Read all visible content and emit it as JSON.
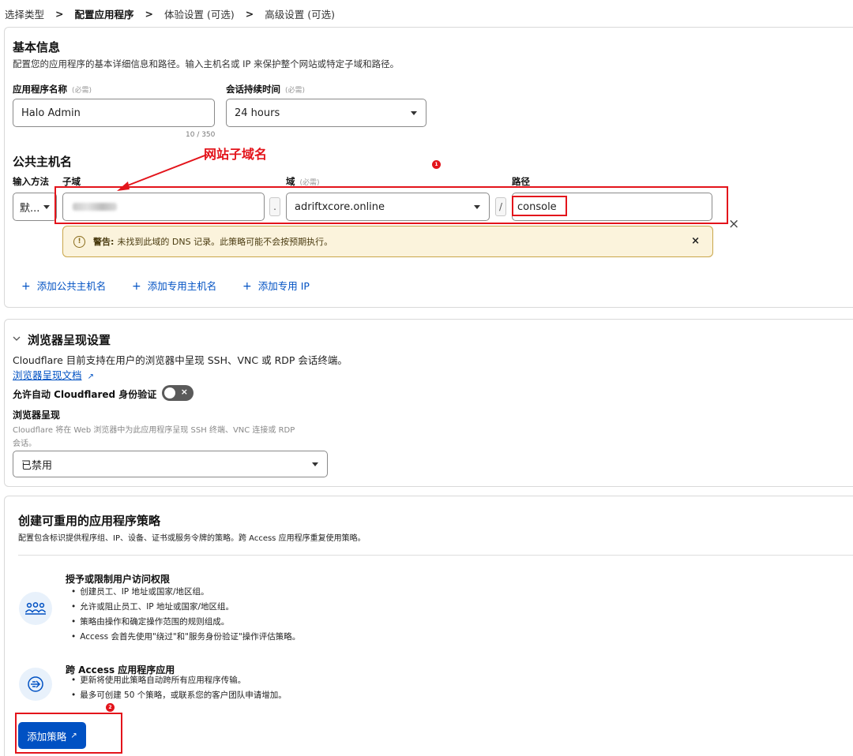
{
  "breadcrumb": {
    "items": [
      "选择类型",
      "配置应用程序",
      "体验设置 (可选)",
      "高级设置 (可选)"
    ],
    "separator": ">"
  },
  "basic_info": {
    "title": "基本信息",
    "description": "配置您的应用程序的基本详细信息和路径。输入主机名或 IP 来保护整个网站或特定子域和路径。",
    "app_name_label": "应用程序名称",
    "app_name_required": "(必需)",
    "app_name_value": "Halo Admin",
    "app_name_counter": "10 / 350",
    "session_label": "会话持续时间",
    "session_required": "(必需)",
    "session_value": "24 hours"
  },
  "public_hostname": {
    "title": "公共主机名",
    "input_method_label": "输入方法",
    "input_method_value": "默...",
    "subdomain_label": "子域",
    "domain_label": "域",
    "domain_required": "(必需)",
    "domain_value": "adriftxcore.online",
    "path_label": "路径",
    "path_value": "console",
    "dot": ".",
    "slash": "/",
    "warning_prefix": "警告:",
    "warning_text": "未找到此域的 DNS 记录。此策略可能不会按预期执行。",
    "add_links": [
      "添加公共主机名",
      "添加专用主机名",
      "添加专用 IP"
    ]
  },
  "annotation": {
    "text": "网站子域名",
    "badge1": "1",
    "badge2": "2",
    "color": "#e3141b"
  },
  "browser_render": {
    "title": "浏览器呈现设置",
    "description": "Cloudflare 目前支持在用户的浏览器中呈现 SSH、VNC 或 RDP 会话终端。",
    "doc_link": "浏览器呈现文档",
    "auto_auth_label": "允许自动 Cloudflared 身份验证",
    "render_label": "浏览器呈现",
    "render_help_line1": "Cloudflare 将在 Web 浏览器中为此应用程序呈现 SSH 终端、VNC 连接或 RDP",
    "render_help_line2": "会话。",
    "render_value": "已禁用"
  },
  "policies": {
    "title": "创建可重用的应用程序策略",
    "description": "配置包含标识提供程序组、IP、设备、证书或服务令牌的策略。跨 Access 应用程序重复使用策略。",
    "block1": {
      "title": "授予或限制用户访问权限",
      "bullets": [
        "创建员工、IP 地址或国家/地区组。",
        "允许或阻止员工、IP 地址或国家/地区组。",
        "策略由操作和确定操作范围的规则组成。",
        "Access 会首先使用\"绕过\"和\"服务身份验证\"操作评估策略。"
      ]
    },
    "block2": {
      "title": "跨 Access 应用程序应用",
      "bullets": [
        "更新将使用此策略自动跨所有应用程序传输。",
        "最多可创建 50 个策略，或联系您的客户团队申请增加。"
      ]
    },
    "add_button": "添加策略"
  },
  "colors": {
    "accent": "#0051c3",
    "warning_bg": "#fbf3dc",
    "annotation_red": "#e3141b"
  }
}
